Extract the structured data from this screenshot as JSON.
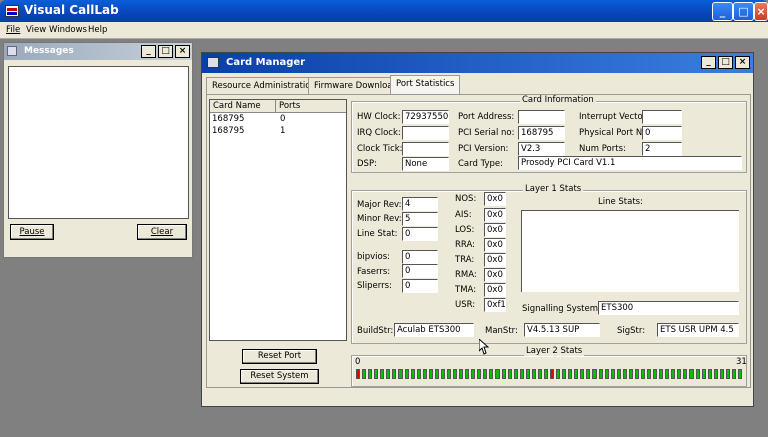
{
  "app": {
    "title": "Visual CallLab",
    "menu": [
      "File",
      "View",
      "Windows",
      "Help"
    ]
  },
  "messages": {
    "title": "Messages",
    "pause_label": "Pause",
    "clear_label": "Clear"
  },
  "card_manager": {
    "title": "Card Manager",
    "tabs": [
      "Resource Administration",
      "Firmware Download",
      "Port Statistics"
    ],
    "list": {
      "headers": [
        "Card Name",
        "Ports"
      ],
      "rows": [
        {
          "name": "168795",
          "ports": "0"
        },
        {
          "name": "168795",
          "ports": "1"
        }
      ]
    },
    "card_info": {
      "title": "Card Information",
      "hw_clock_label": "HW Clock:",
      "hw_clock": "72937550",
      "irq_clock_label": "IRQ Clock:",
      "irq_clock": "",
      "clock_tick_label": "Clock Tick:",
      "clock_tick": "",
      "dsp_label": "DSP:",
      "dsp": "None",
      "port_address_label": "Port Address:",
      "port_address": "",
      "pci_serial_label": "PCI Serial no:",
      "pci_serial": "168795",
      "pci_version_label": "PCI Version:",
      "pci_version": "V2.3",
      "card_type_label": "Card Type:",
      "card_type": "Prosody PCI Card V1.1",
      "interrupt_vector_label": "Interrupt Vector:",
      "interrupt_vector": "",
      "physical_port_label": "Physical Port No:",
      "physical_port": "0",
      "num_ports_label": "Num Ports:",
      "num_ports": "2"
    },
    "layer1": {
      "title": "Layer 1 Stats",
      "major_rev_label": "Major Rev:",
      "major_rev": "4",
      "minor_rev_label": "Minor Rev:",
      "minor_rev": "5",
      "line_stat_label": "Line Stat:",
      "line_stat": "0",
      "bipvios_label": "bipvios:",
      "bipvios": "0",
      "faserrs_label": "Faserrs:",
      "faserrs": "0",
      "sliperrs_label": "Sliperrs:",
      "sliperrs": "0",
      "nos_label": "NOS:",
      "nos": "0x0",
      "ais_label": "AIS:",
      "ais": "0x0",
      "los_label": "LOS:",
      "los": "0x0",
      "rra_label": "RRA:",
      "rra": "0x0",
      "tra_label": "TRA:",
      "tra": "0x0",
      "rma_label": "RMA:",
      "rma": "0x0",
      "tma_label": "TMA:",
      "tma": "0x0",
      "usr_label": "USR:",
      "usr": "0xf1",
      "line_stats_label": "Line Stats:",
      "signalling_label": "Signalling System:",
      "signalling": "ETS300",
      "buildstr_label": "BuildStr:",
      "buildstr": "Aculab ETS300",
      "manstr_label": "ManStr:",
      "manstr": "V4.5.13 SUP",
      "sigstr_label": "SigStr:",
      "sigstr": "ETS USR UPM 4.5"
    },
    "reset_port_label": "Reset Port",
    "reset_system_label": "Reset System",
    "layer2": {
      "title": "Layer 2 Stats",
      "start_label": "0",
      "end_label": "31",
      "channels": [
        "red",
        "green",
        "green",
        "green",
        "green",
        "green",
        "green",
        "green",
        "green",
        "green",
        "green",
        "green",
        "green",
        "green",
        "green",
        "green",
        "green",
        "green",
        "green",
        "green",
        "green",
        "green",
        "green",
        "green",
        "green",
        "green",
        "green",
        "green",
        "green",
        "green",
        "green",
        "green",
        "red",
        "green",
        "green",
        "green",
        "green",
        "green",
        "green",
        "green",
        "green",
        "green",
        "green",
        "green",
        "green",
        "green",
        "green",
        "green",
        "green",
        "green",
        "green",
        "green",
        "green",
        "green",
        "green",
        "green",
        "green",
        "green",
        "green",
        "green",
        "green",
        "green",
        "green",
        "green"
      ],
      "colors": {
        "green": "#00c000",
        "red": "#e00000"
      }
    }
  }
}
